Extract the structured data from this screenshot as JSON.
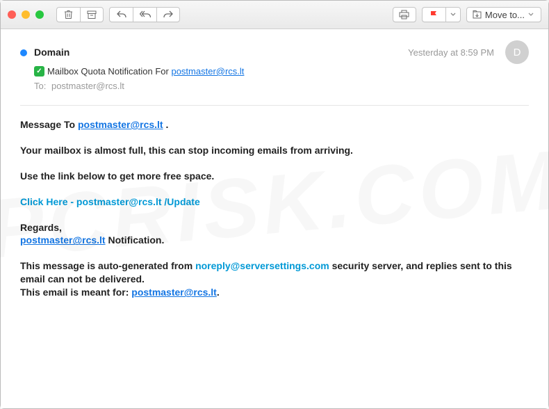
{
  "toolbar": {
    "move_label": "Move to..."
  },
  "traffic_colors": {
    "close": "#ff5f57",
    "min": "#ffbd2e",
    "max": "#28c840"
  },
  "header": {
    "sender": "Domain",
    "timestamp": "Yesterday at 8:59 PM",
    "avatar_initial": "D",
    "subject_prefix": "Mailbox Quota Notification For ",
    "subject_email": "postmaster@rcs.lt",
    "to_label": "To:",
    "to_value": "postmaster@rcs.lt"
  },
  "body": {
    "msg_to_prefix": "Message To  ",
    "msg_to_email": "postmaster@rcs.lt",
    "msg_to_suffix": " .",
    "p1": "Your mailbox is almost full, this can stop incoming emails from arriving.",
    "p2": "Use the link below to get more free space.",
    "click_link": "Click Here - postmaster@rcs.lt /Update",
    "regards": "Regards,",
    "sig_email": "postmaster@rcs.lt",
    "sig_suffix": "  Notification.",
    "footer1_a": "This message is auto-generated from ",
    "footer1_link": "noreply@serversettings.com",
    "footer1_b": " security server, and replies sent to this email can not be delivered.",
    "footer2_a": "This email is meant for: ",
    "footer2_link": "postmaster@rcs.lt",
    "footer2_b": "."
  },
  "watermark": "PCRISK.COM"
}
